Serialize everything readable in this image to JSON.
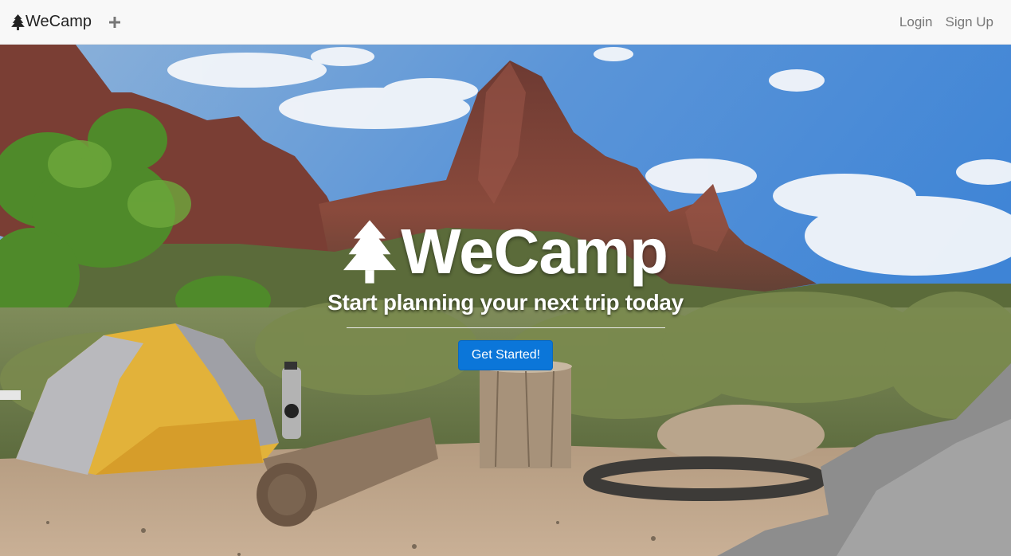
{
  "navbar": {
    "brand": "WeCamp",
    "brand_icon": "tree-icon",
    "add_icon": "plus-icon",
    "links": {
      "login": "Login",
      "signup": "Sign Up"
    }
  },
  "hero": {
    "title": "WeCamp",
    "title_icon": "tree-icon",
    "subtitle": "Start planning your next trip today",
    "cta_label": "Get Started!"
  },
  "colors": {
    "navbar_bg": "#f8f8f8",
    "nav_link": "#777777",
    "cta_bg": "#0b76d9",
    "hero_text": "#ffffff"
  }
}
